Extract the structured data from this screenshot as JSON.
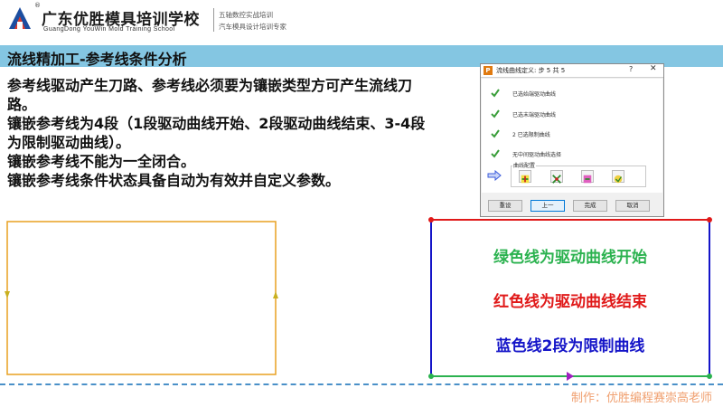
{
  "header": {
    "logo_cn": "广东优胜模具培训学校",
    "logo_en": "GuangDong YouWin Mold Training School",
    "logo_reg": "®",
    "tagline1": "五轴数控实战培训",
    "tagline2": "汽车模具设计培训专家"
  },
  "title_bar": {
    "title": "流线精加工-参考线条件分析"
  },
  "body": {
    "paragraphs": [
      "参考线驱动产生刀路、参考线必须要为镶嵌类型方可产生流线刀路。",
      "镶嵌参考线为4段（1段驱动曲线开始、2段驱动曲线结束、3-4段为限制驱动曲线）。",
      "镶嵌参考线不能为一全闭合。",
      "镶嵌参考线条件状态具备自动为有效并自定义参数。"
    ]
  },
  "dialog": {
    "app_icon": "P",
    "title": "流线曲线定义: 步 5 共 5",
    "help": "?",
    "close": "✕",
    "steps": [
      {
        "label": "已选始端驱动曲线",
        "icon": "check-icon"
      },
      {
        "label": "已选末端驱动曲线",
        "icon": "check-icon"
      },
      {
        "label": "2 已选限制曲线",
        "icon": "check-icon"
      },
      {
        "label": "无中间驱动曲线选择",
        "icon": "check-icon"
      }
    ],
    "group_label": "曲线配置",
    "tool_buttons": [
      "curve-config-icon-1",
      "curve-config-icon-2",
      "curve-config-icon-3",
      "curve-config-icon-4"
    ],
    "buttons": {
      "reset": "重设",
      "back": "上一",
      "finish": "完成",
      "cancel": "取消"
    },
    "colors": {
      "check": "#3a9e3a",
      "arrow": "#3b5bdb"
    }
  },
  "legend": {
    "green": "绿色线为驱动曲线开始",
    "red": "红色线为驱动曲线结束",
    "blue": "蓝色线2段为限制曲线",
    "colors": {
      "green": "#2bb24f",
      "red": "#e01919",
      "blue": "#1414c8"
    }
  },
  "left_shape": {
    "stroke": "#e8a020",
    "arrow": "#c8b020"
  },
  "footer": {
    "credit": "制作：优胜编程赛崇高老师"
  }
}
